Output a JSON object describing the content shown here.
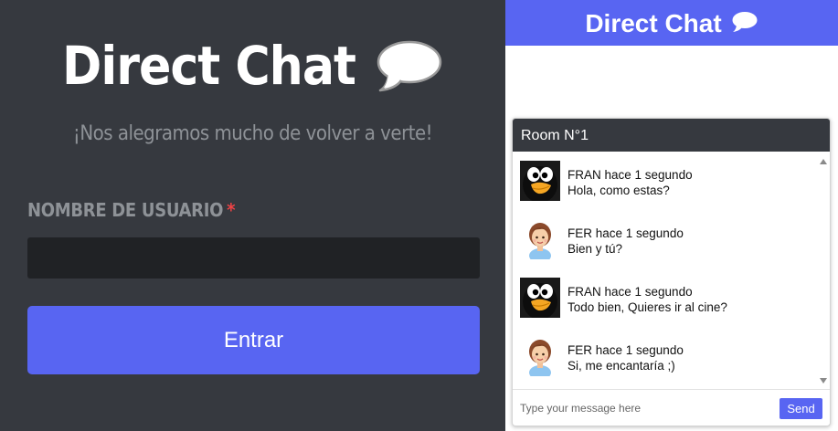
{
  "login": {
    "title": "Direct Chat",
    "subtitle": "¡Nos alegramos mucho de volver a verte!",
    "username_label": "NOMBRE DE USUARIO",
    "required_mark": "*",
    "username_value": "",
    "enter_label": "Entrar"
  },
  "header": {
    "title": "Direct Chat"
  },
  "room": {
    "name": "Room N°1",
    "messages": [
      {
        "author": "FRAN",
        "time": "hace 1 segundo",
        "meta": "FRAN hace 1 segundo",
        "text": "Hola, como estas?",
        "avatar": "penguin-avatar"
      },
      {
        "author": "FER",
        "time": "hace 1 segundo",
        "meta": "FER hace 1 segundo",
        "text": "Bien y tú?",
        "avatar": "girl-avatar"
      },
      {
        "author": "FRAN",
        "time": "hace 1 segundo",
        "meta": "FRAN hace 1 segundo",
        "text": "Todo bien, Quieres ir al cine?",
        "avatar": "penguin-avatar"
      },
      {
        "author": "FER",
        "time": "hace 1 segundo",
        "meta": "FER hace 1 segundo",
        "text": "Si, me encantaría ;)",
        "avatar": "girl-avatar"
      }
    ],
    "input_placeholder": "Type your message here",
    "input_value": "",
    "send_label": "Send"
  },
  "colors": {
    "accent": "#5865f2",
    "login_bg": "#36393f",
    "input_bg": "#202225",
    "required": "#ed4245"
  }
}
